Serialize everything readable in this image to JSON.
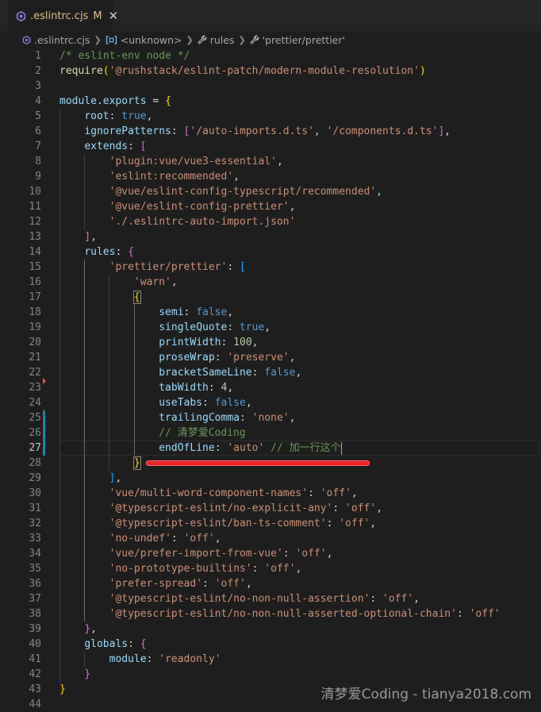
{
  "tab": {
    "icon": "eslint-config-icon",
    "label": ".eslintrc.cjs",
    "modified": "M",
    "close": "✕"
  },
  "breadcrumb": {
    "items": [
      {
        "label": ".eslintrc.cjs",
        "icon": "eslint-config-icon"
      },
      {
        "label": "<unknown>",
        "icon": "module-icon"
      },
      {
        "label": "rules",
        "icon": "wrench-icon"
      },
      {
        "label": "'prettier/prettier'",
        "icon": "wrench-icon"
      }
    ]
  },
  "editor": {
    "active_line": 27,
    "lines": [
      {
        "n": "1",
        "tokens": [
          [
            "t-comment",
            "/* eslint-env node */"
          ]
        ]
      },
      {
        "n": "2",
        "tokens": [
          [
            "t-fn",
            "require"
          ],
          [
            "t-b1",
            "("
          ],
          [
            "t-str",
            "'@rushstack/eslint-patch/modern-module-resolution'"
          ],
          [
            "t-b1",
            ")"
          ]
        ]
      },
      {
        "n": "3",
        "tokens": []
      },
      {
        "n": "4",
        "tokens": [
          [
            "t-var",
            "module"
          ],
          [
            "t-p",
            "."
          ],
          [
            "t-var",
            "exports"
          ],
          [
            "t-p",
            " = "
          ],
          [
            "t-b1",
            "{"
          ]
        ]
      },
      {
        "n": "5",
        "tokens": [
          [
            "t-p",
            "    "
          ],
          [
            "t-var",
            "root"
          ],
          [
            "t-p",
            ": "
          ],
          [
            "t-kw",
            "true"
          ],
          [
            "t-p",
            ","
          ]
        ]
      },
      {
        "n": "6",
        "tokens": [
          [
            "t-p",
            "    "
          ],
          [
            "t-var",
            "ignorePatterns"
          ],
          [
            "t-p",
            ": "
          ],
          [
            "t-b2",
            "["
          ],
          [
            "t-str",
            "'/auto-imports.d.ts'"
          ],
          [
            "t-p",
            ", "
          ],
          [
            "t-str",
            "'/components.d.ts'"
          ],
          [
            "t-b2",
            "]"
          ],
          [
            "t-p",
            ","
          ]
        ]
      },
      {
        "n": "7",
        "tokens": [
          [
            "t-p",
            "    "
          ],
          [
            "t-var",
            "extends"
          ],
          [
            "t-p",
            ": "
          ],
          [
            "t-b2",
            "["
          ]
        ]
      },
      {
        "n": "8",
        "tokens": [
          [
            "t-p",
            "        "
          ],
          [
            "t-str",
            "'plugin:vue/vue3-essential'"
          ],
          [
            "t-p",
            ","
          ]
        ]
      },
      {
        "n": "9",
        "tokens": [
          [
            "t-p",
            "        "
          ],
          [
            "t-str",
            "'eslint:recommended'"
          ],
          [
            "t-p",
            ","
          ]
        ]
      },
      {
        "n": "10",
        "tokens": [
          [
            "t-p",
            "        "
          ],
          [
            "t-str",
            "'@vue/eslint-config-typescript/recommended'"
          ],
          [
            "t-p",
            ","
          ]
        ]
      },
      {
        "n": "11",
        "tokens": [
          [
            "t-p",
            "        "
          ],
          [
            "t-str",
            "'@vue/eslint-config-prettier'"
          ],
          [
            "t-p",
            ","
          ]
        ]
      },
      {
        "n": "12",
        "tokens": [
          [
            "t-p",
            "        "
          ],
          [
            "t-str",
            "'./.eslintrc-auto-import.json'"
          ]
        ]
      },
      {
        "n": "13",
        "tokens": [
          [
            "t-p",
            "    "
          ],
          [
            "t-b2",
            "]"
          ],
          [
            "t-p",
            ","
          ]
        ]
      },
      {
        "n": "14",
        "tokens": [
          [
            "t-p",
            "    "
          ],
          [
            "t-var",
            "rules"
          ],
          [
            "t-p",
            ": "
          ],
          [
            "t-b2",
            "{"
          ]
        ]
      },
      {
        "n": "15",
        "tokens": [
          [
            "t-p",
            "        "
          ],
          [
            "t-str",
            "'prettier/prettier'"
          ],
          [
            "t-p",
            ": "
          ],
          [
            "t-b3",
            "["
          ]
        ]
      },
      {
        "n": "16",
        "tokens": [
          [
            "t-p",
            "            "
          ],
          [
            "t-str",
            "'warn'"
          ],
          [
            "t-p",
            ","
          ]
        ]
      },
      {
        "n": "17",
        "tokens": [
          [
            "t-p",
            "            "
          ],
          [
            "t-b1",
            "{"
          ]
        ]
      },
      {
        "n": "18",
        "tokens": [
          [
            "t-p",
            "                "
          ],
          [
            "t-var",
            "semi"
          ],
          [
            "t-p",
            ": "
          ],
          [
            "t-kw",
            "false"
          ],
          [
            "t-p",
            ","
          ]
        ]
      },
      {
        "n": "19",
        "tokens": [
          [
            "t-p",
            "                "
          ],
          [
            "t-var",
            "singleQuote"
          ],
          [
            "t-p",
            ": "
          ],
          [
            "t-kw",
            "true"
          ],
          [
            "t-p",
            ","
          ]
        ]
      },
      {
        "n": "20",
        "tokens": [
          [
            "t-p",
            "                "
          ],
          [
            "t-var",
            "printWidth"
          ],
          [
            "t-p",
            ": "
          ],
          [
            "t-num",
            "100"
          ],
          [
            "t-p",
            ","
          ]
        ]
      },
      {
        "n": "21",
        "tokens": [
          [
            "t-p",
            "                "
          ],
          [
            "t-var",
            "proseWrap"
          ],
          [
            "t-p",
            ": "
          ],
          [
            "t-str",
            "'preserve'"
          ],
          [
            "t-p",
            ","
          ]
        ]
      },
      {
        "n": "22",
        "tokens": [
          [
            "t-p",
            "                "
          ],
          [
            "t-var",
            "bracketSameLine"
          ],
          [
            "t-p",
            ": "
          ],
          [
            "t-kw",
            "false"
          ],
          [
            "t-p",
            ","
          ]
        ]
      },
      {
        "n": "23",
        "tokens": [
          [
            "t-p",
            "                "
          ],
          [
            "t-var",
            "tabWidth"
          ],
          [
            "t-p",
            ": "
          ],
          [
            "t-num",
            "4"
          ],
          [
            "t-p",
            ","
          ]
        ]
      },
      {
        "n": "24",
        "tokens": [
          [
            "t-p",
            "                "
          ],
          [
            "t-var",
            "useTabs"
          ],
          [
            "t-p",
            ": "
          ],
          [
            "t-kw",
            "false"
          ],
          [
            "t-p",
            ","
          ]
        ]
      },
      {
        "n": "25",
        "tokens": [
          [
            "t-p",
            "                "
          ],
          [
            "t-var",
            "trailingComma"
          ],
          [
            "t-p",
            ": "
          ],
          [
            "t-str",
            "'none'"
          ],
          [
            "t-p",
            ","
          ]
        ]
      },
      {
        "n": "26",
        "tokens": [
          [
            "t-p",
            "                "
          ],
          [
            "t-comment",
            "// 清梦爱Coding"
          ]
        ]
      },
      {
        "n": "27",
        "tokens": [
          [
            "t-p",
            "                "
          ],
          [
            "t-var",
            "endOfLine"
          ],
          [
            "t-p",
            ": "
          ],
          [
            "t-str",
            "'auto'"
          ],
          [
            "t-p",
            " "
          ],
          [
            "t-comment",
            "// 加一行这个"
          ]
        ]
      },
      {
        "n": "28",
        "tokens": [
          [
            "t-p",
            "            "
          ],
          [
            "t-b1",
            "}"
          ]
        ]
      },
      {
        "n": "29",
        "tokens": [
          [
            "t-p",
            "        "
          ],
          [
            "t-b3",
            "]"
          ],
          [
            "t-p",
            ","
          ]
        ]
      },
      {
        "n": "30",
        "tokens": [
          [
            "t-p",
            "        "
          ],
          [
            "t-str",
            "'vue/multi-word-component-names'"
          ],
          [
            "t-p",
            ": "
          ],
          [
            "t-str",
            "'off'"
          ],
          [
            "t-p",
            ","
          ]
        ]
      },
      {
        "n": "31",
        "tokens": [
          [
            "t-p",
            "        "
          ],
          [
            "t-str",
            "'@typescript-eslint/no-explicit-any'"
          ],
          [
            "t-p",
            ": "
          ],
          [
            "t-str",
            "'off'"
          ],
          [
            "t-p",
            ","
          ]
        ]
      },
      {
        "n": "32",
        "tokens": [
          [
            "t-p",
            "        "
          ],
          [
            "t-str",
            "'@typescript-eslint/ban-ts-comment'"
          ],
          [
            "t-p",
            ": "
          ],
          [
            "t-str",
            "'off'"
          ],
          [
            "t-p",
            ","
          ]
        ]
      },
      {
        "n": "33",
        "tokens": [
          [
            "t-p",
            "        "
          ],
          [
            "t-str",
            "'no-undef'"
          ],
          [
            "t-p",
            ": "
          ],
          [
            "t-str",
            "'off'"
          ],
          [
            "t-p",
            ","
          ]
        ]
      },
      {
        "n": "34",
        "tokens": [
          [
            "t-p",
            "        "
          ],
          [
            "t-str",
            "'vue/prefer-import-from-vue'"
          ],
          [
            "t-p",
            ": "
          ],
          [
            "t-str",
            "'off'"
          ],
          [
            "t-p",
            ","
          ]
        ]
      },
      {
        "n": "35",
        "tokens": [
          [
            "t-p",
            "        "
          ],
          [
            "t-str",
            "'no-prototype-builtins'"
          ],
          [
            "t-p",
            ": "
          ],
          [
            "t-str",
            "'off'"
          ],
          [
            "t-p",
            ","
          ]
        ]
      },
      {
        "n": "36",
        "tokens": [
          [
            "t-p",
            "        "
          ],
          [
            "t-str",
            "'prefer-spread'"
          ],
          [
            "t-p",
            ": "
          ],
          [
            "t-str",
            "'off'"
          ],
          [
            "t-p",
            ","
          ]
        ]
      },
      {
        "n": "37",
        "tokens": [
          [
            "t-p",
            "        "
          ],
          [
            "t-str",
            "'@typescript-eslint/no-non-null-assertion'"
          ],
          [
            "t-p",
            ": "
          ],
          [
            "t-str",
            "'off'"
          ],
          [
            "t-p",
            ","
          ]
        ]
      },
      {
        "n": "38",
        "tokens": [
          [
            "t-p",
            "        "
          ],
          [
            "t-str",
            "'@typescript-eslint/no-non-null-asserted-optional-chain'"
          ],
          [
            "t-p",
            ": "
          ],
          [
            "t-str",
            "'off'"
          ]
        ]
      },
      {
        "n": "39",
        "tokens": [
          [
            "t-p",
            "    "
          ],
          [
            "t-b2",
            "}"
          ],
          [
            "t-p",
            ","
          ]
        ]
      },
      {
        "n": "40",
        "tokens": [
          [
            "t-p",
            "    "
          ],
          [
            "t-var",
            "globals"
          ],
          [
            "t-p",
            ": "
          ],
          [
            "t-b2",
            "{"
          ]
        ]
      },
      {
        "n": "41",
        "tokens": [
          [
            "t-p",
            "        "
          ],
          [
            "t-var",
            "module"
          ],
          [
            "t-p",
            ": "
          ],
          [
            "t-str",
            "'readonly'"
          ]
        ]
      },
      {
        "n": "42",
        "tokens": [
          [
            "t-p",
            "    "
          ],
          [
            "t-b2",
            "}"
          ]
        ]
      },
      {
        "n": "43",
        "tokens": [
          [
            "t-b1",
            "}"
          ]
        ]
      },
      {
        "n": "44",
        "tokens": []
      }
    ]
  },
  "watermark": "清梦爱Coding - tianya2018.com",
  "colors": {
    "background": "#1e1e1e",
    "tab_modified": "#e2c08d",
    "annotation_underline": "#e8262a"
  }
}
